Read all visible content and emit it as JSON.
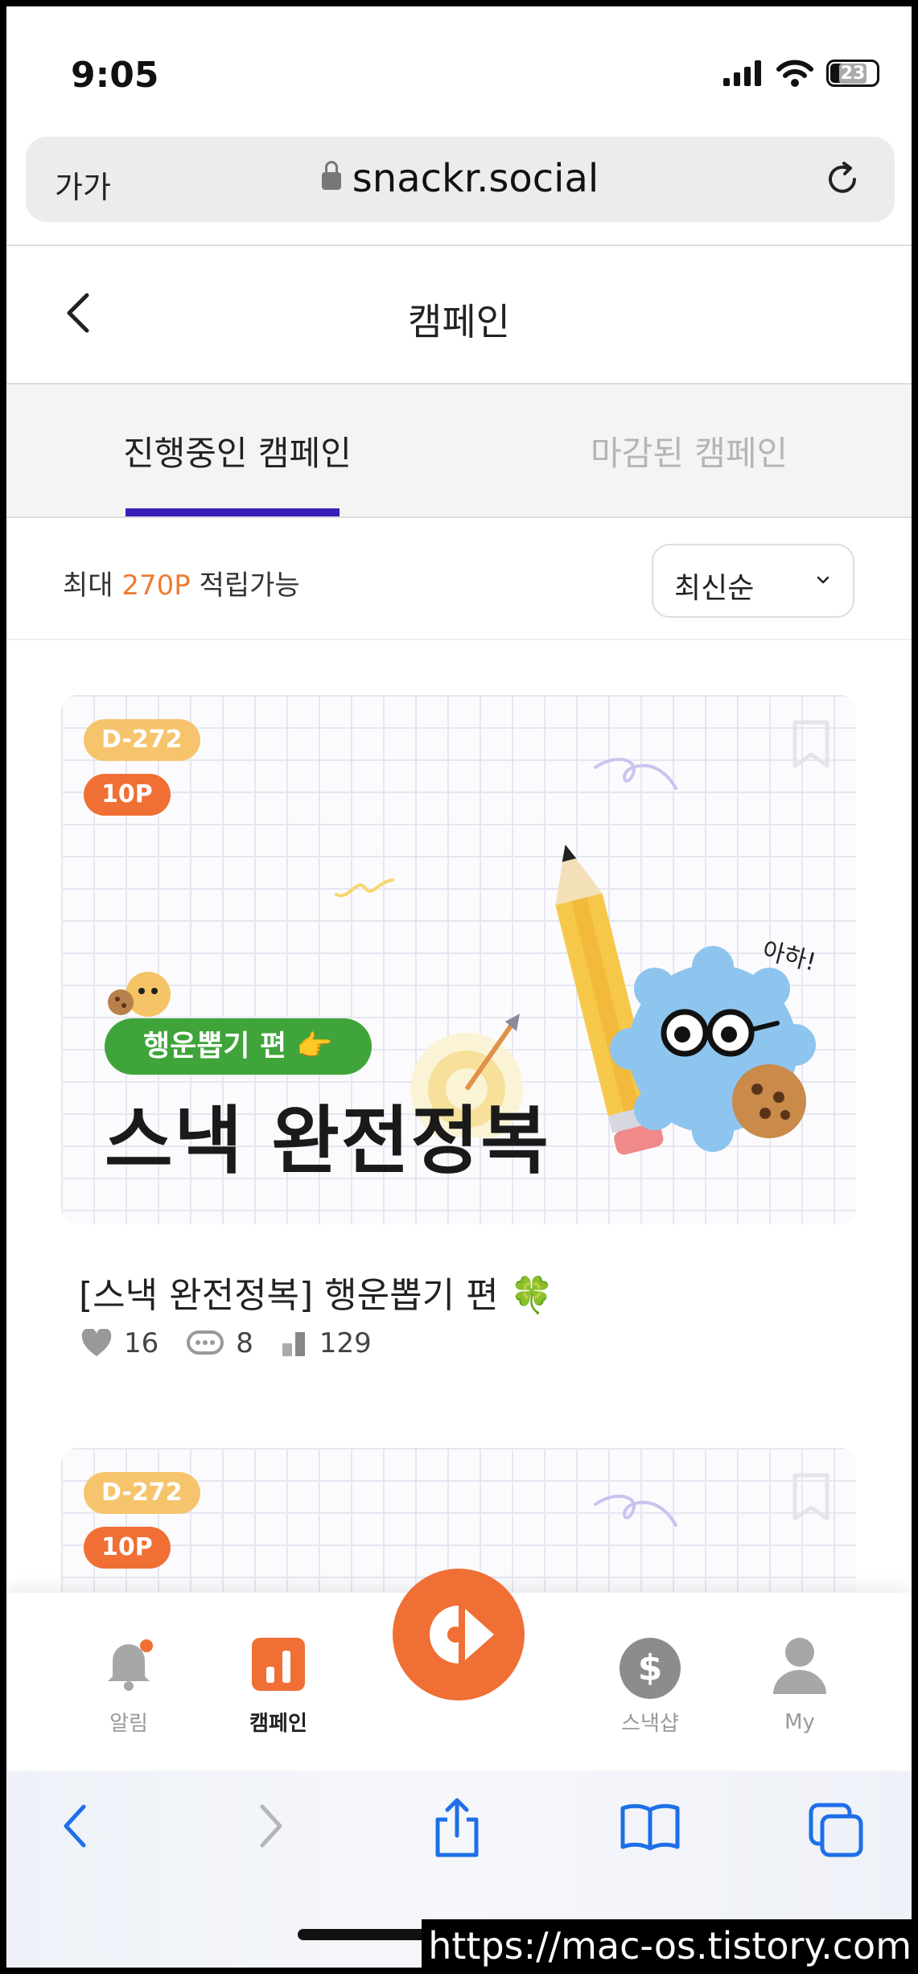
{
  "status_bar": {
    "time": "9:05",
    "battery": "23"
  },
  "browser": {
    "text_size_label": "가가",
    "url": "snackr.social"
  },
  "header": {
    "title": "캠페인"
  },
  "tabs": [
    {
      "label": "진행중인 캠페인",
      "active": true
    },
    {
      "label": "마감된 캠페인",
      "active": false
    }
  ],
  "filter": {
    "points_prefix": "최대 ",
    "points_value": "270P",
    "points_suffix": " 적립가능",
    "sort_label": "최신순"
  },
  "campaigns": [
    {
      "d_day": "D-272",
      "points": "10P",
      "banner_pill": "행운뽑기 편 👉",
      "banner_headline": "스낵 완전정복",
      "banner_exclaim": "아하!",
      "title": "[스낵 완전정복] 행운뽑기 편 🍀",
      "likes": "16",
      "comments": "8",
      "views": "129"
    },
    {
      "d_day": "D-272",
      "points": "10P"
    }
  ],
  "tabbar": {
    "items": [
      {
        "label": "알림",
        "icon": "bell-icon"
      },
      {
        "label": "캠페인",
        "icon": "campaign-chart-icon",
        "active": true
      },
      {
        "label": "",
        "icon": "snackr-logo-icon"
      },
      {
        "label": "스낵샵",
        "icon": "dollar-coin-icon"
      },
      {
        "label": "My",
        "icon": "person-icon"
      }
    ]
  },
  "colors": {
    "accent": "#EF6F34",
    "tab_underline": "#3A1CB8",
    "badge_yellow": "#F6C46D",
    "pill_green": "#3FA53A"
  },
  "watermark": "https://mac-os.tistory.com"
}
